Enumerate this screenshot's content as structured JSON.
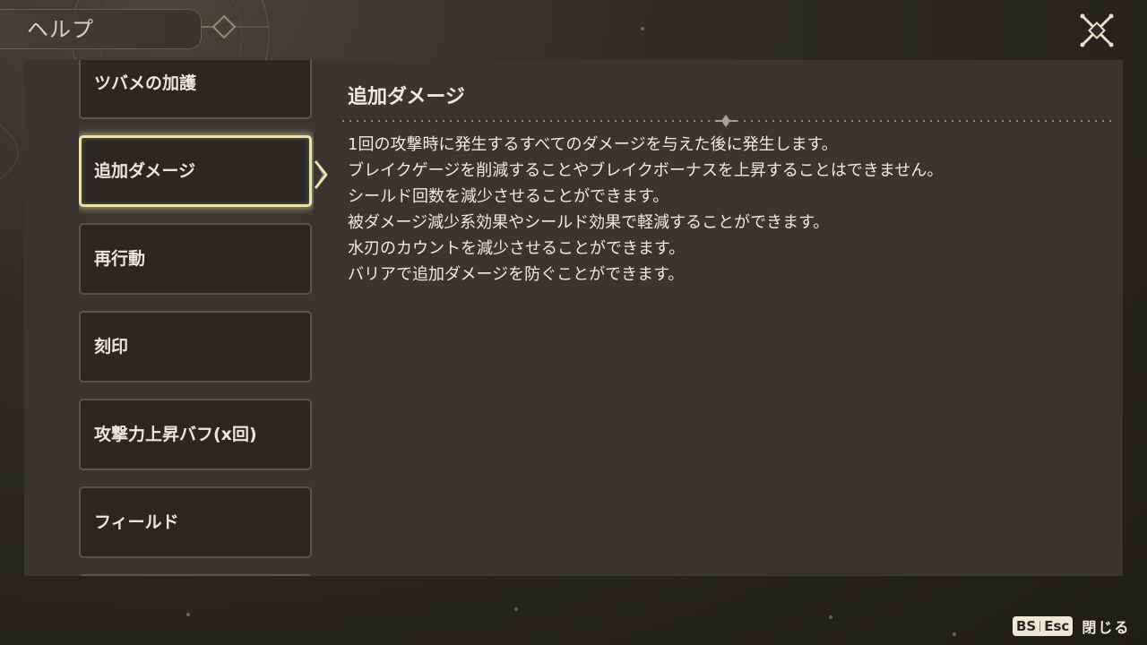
{
  "header": {
    "title": "ヘルプ"
  },
  "list": {
    "items": [
      {
        "label": "ツバメの加護"
      },
      {
        "label": "追加ダメージ"
      },
      {
        "label": "再行動"
      },
      {
        "label": "刻印"
      },
      {
        "label": "攻撃力上昇バフ(x回)"
      },
      {
        "label": "フィールド"
      }
    ],
    "selected": "追加ダメージ"
  },
  "content": {
    "title": "追加ダメージ",
    "lines": [
      "1回の攻撃時に発生するすべてのダメージを与えた後に発生します。",
      "ブレイクゲージを削減することやブレイクボーナスを上昇することはできません。",
      "シールド回数を減少させることができます。",
      "被ダメージ減少系効果やシールド効果で軽減することができます。",
      "水刃のカウントを減少させることができます。",
      "バリアで追加ダメージを防ぐことができます。"
    ]
  },
  "footer": {
    "key1": "BS",
    "key2": "Esc",
    "label": "閉じる"
  },
  "colors": {
    "selected_border": "#efe3a8",
    "panel_bg": "#393632",
    "item_bg": "#2b2824"
  }
}
